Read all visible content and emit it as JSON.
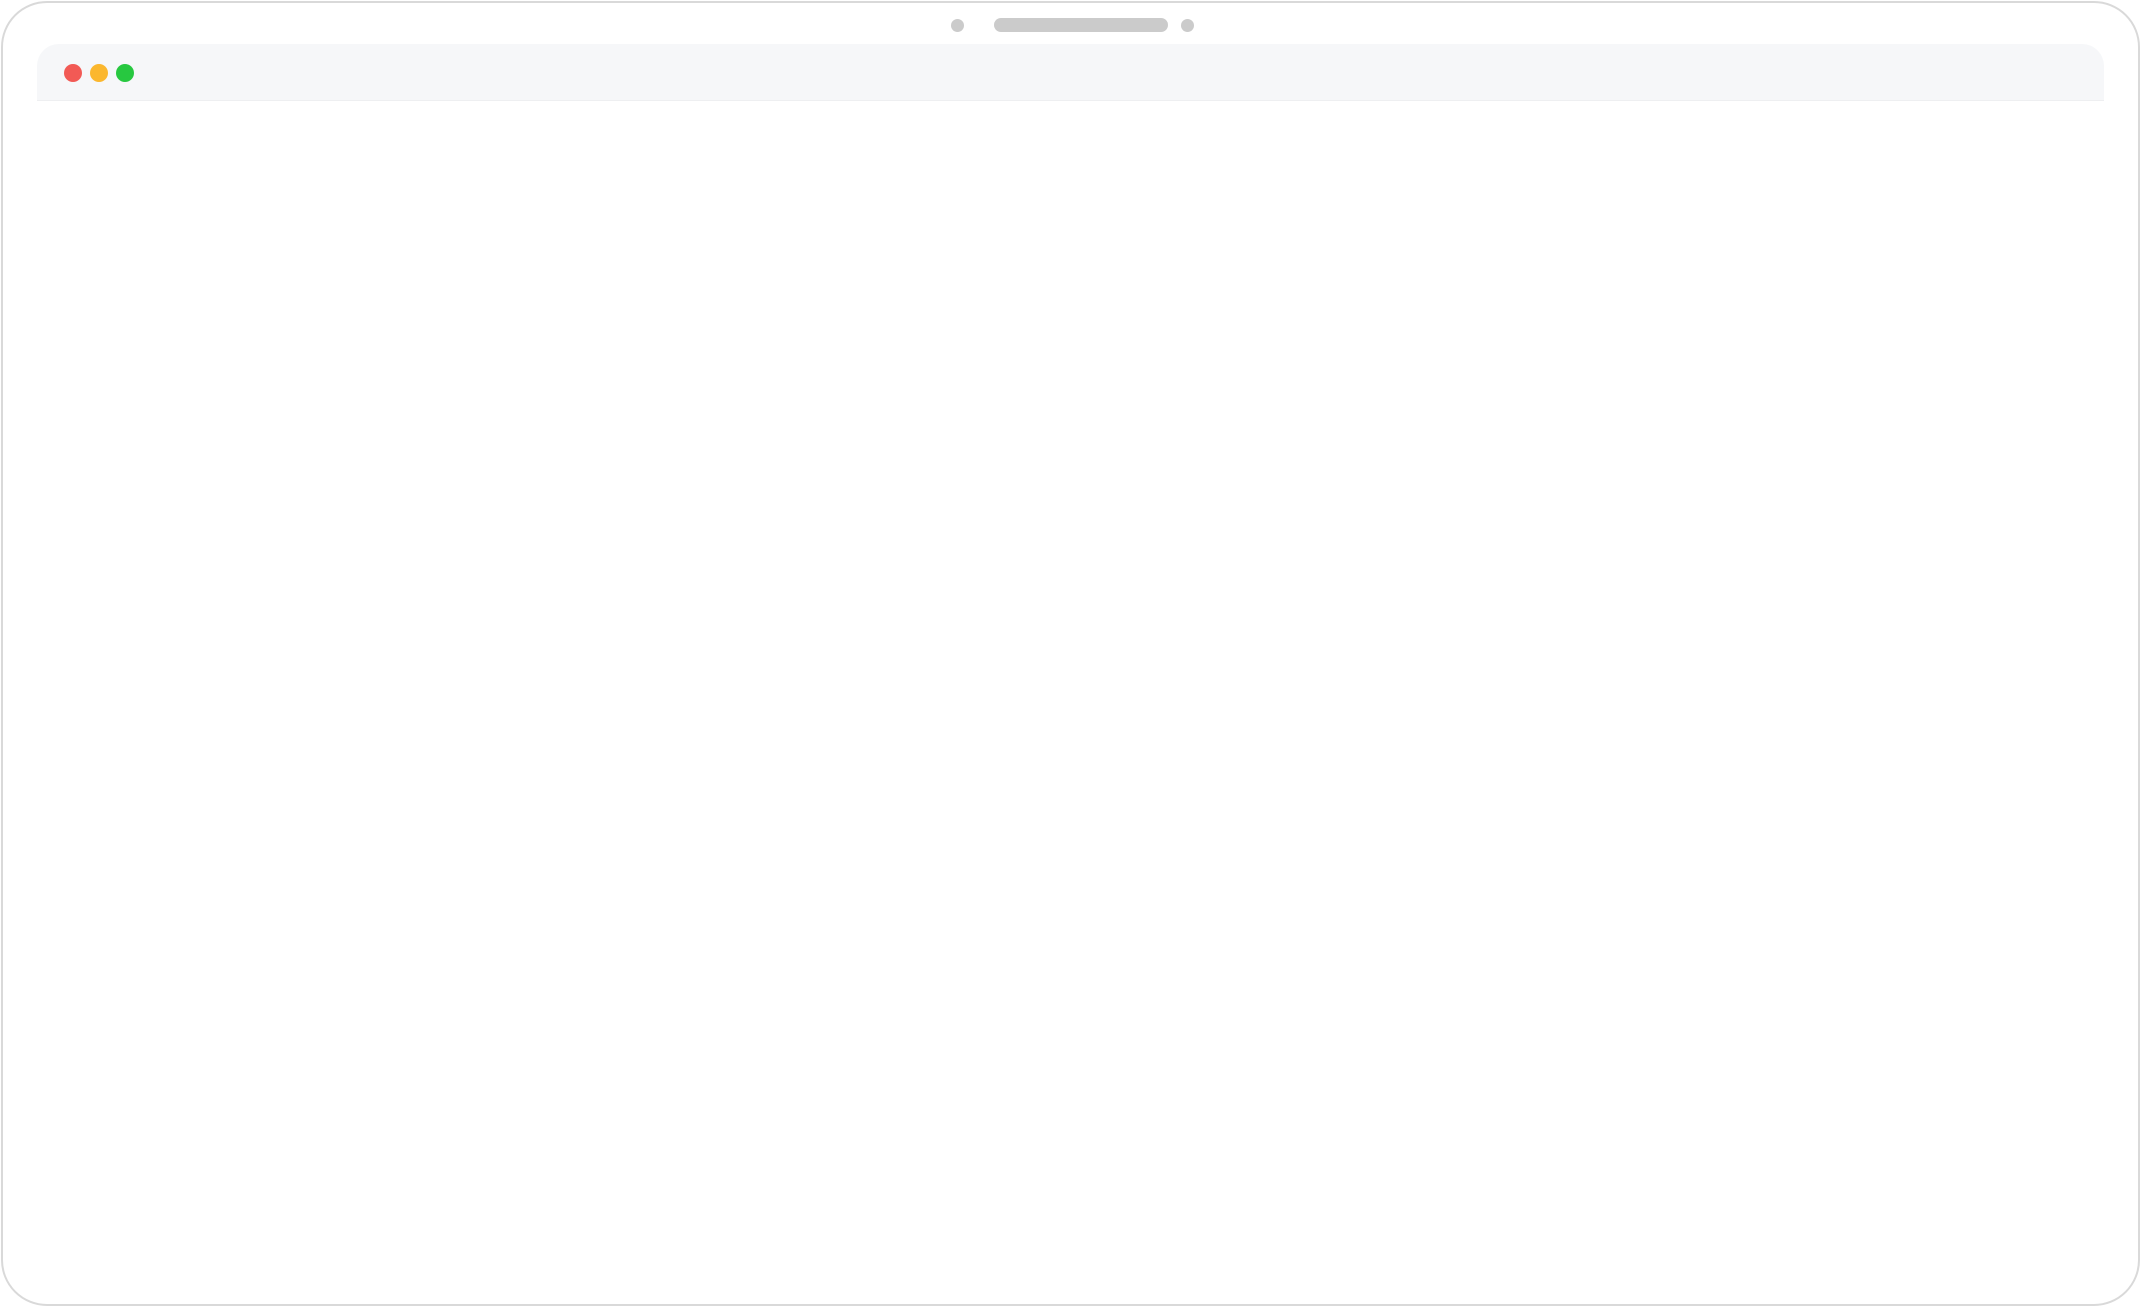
{
  "window": {
    "title": "",
    "content_text": ""
  },
  "colors": {
    "frame_border": "#d9d9d9",
    "device_accent": "#cbcbcb",
    "titlebar_background": "#f6f7f9",
    "content_background": "#ffffff",
    "close_button": "#f25a55",
    "minimize_button": "#fbb72e",
    "maximize_button": "#27c840"
  },
  "icons": {
    "close": "close-icon",
    "minimize": "minimize-icon",
    "maximize": "maximize-icon"
  }
}
